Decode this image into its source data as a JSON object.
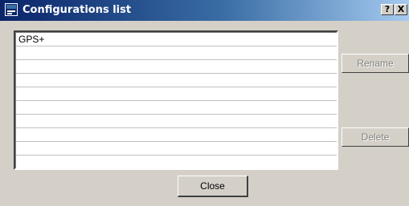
{
  "window": {
    "title": "Configurations list",
    "icon": "app-window-icon",
    "help_label": "?",
    "close_label": "X",
    "colors": {
      "face": "#d4d0c8",
      "title_start": "#0a246a",
      "title_end": "#a6caf0"
    }
  },
  "list": {
    "items": [
      {
        "label": "GPS+"
      },
      {
        "label": ""
      },
      {
        "label": ""
      },
      {
        "label": ""
      },
      {
        "label": ""
      },
      {
        "label": ""
      },
      {
        "label": ""
      },
      {
        "label": ""
      },
      {
        "label": ""
      },
      {
        "label": ""
      }
    ]
  },
  "actions": {
    "rename_label": "Rename",
    "rename_enabled": false,
    "delete_label": "Delete",
    "delete_enabled": false,
    "close_label": "Close"
  }
}
